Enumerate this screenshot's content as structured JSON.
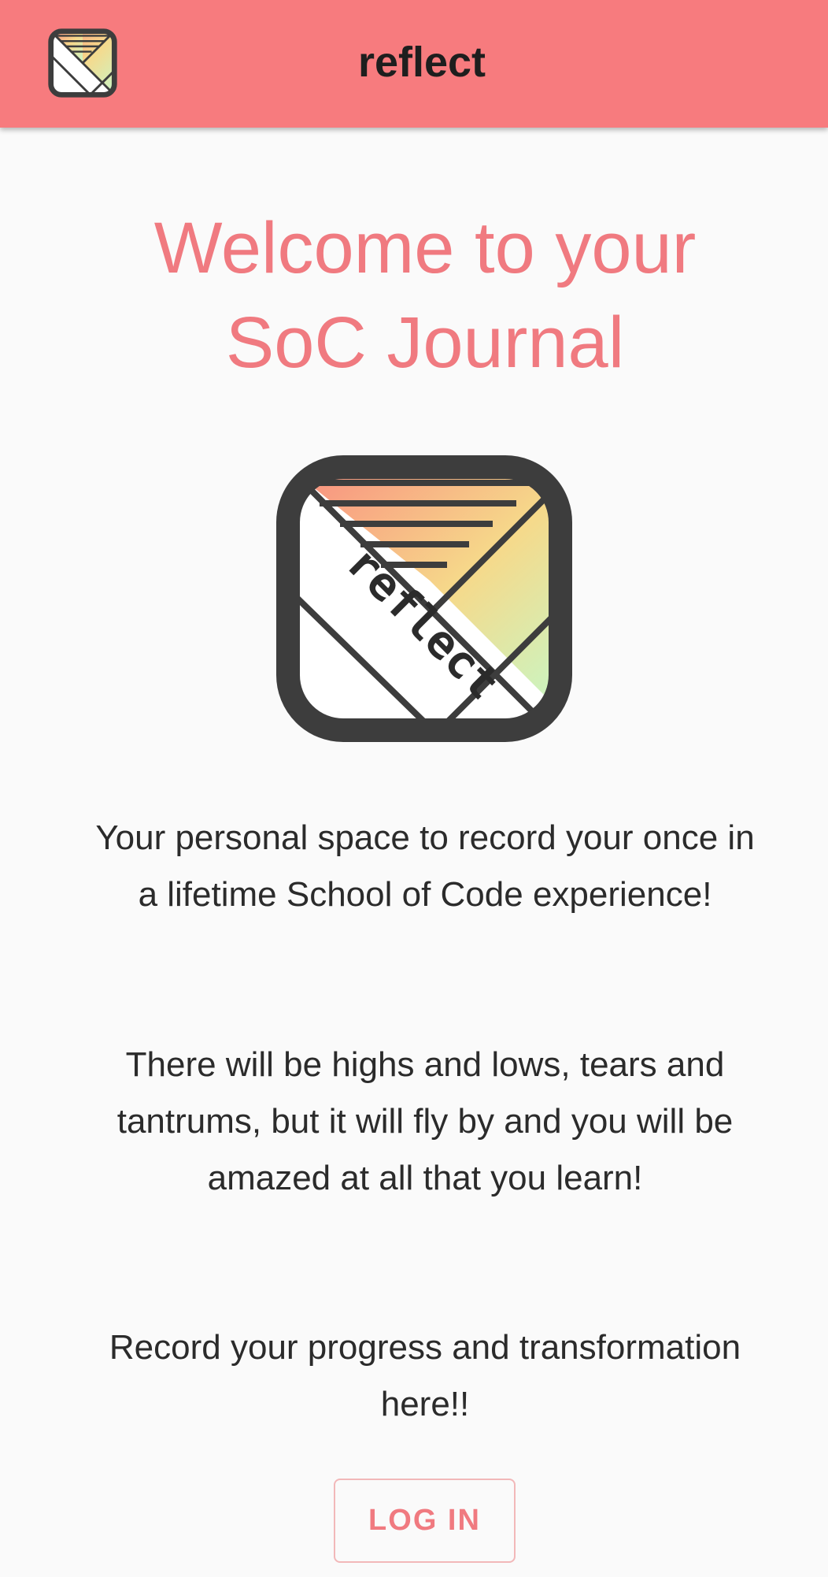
{
  "header": {
    "title": "reflect",
    "logo_icon": "reflect-app-logo-icon"
  },
  "main": {
    "welcome_line_1": "Welcome to your",
    "welcome_line_2": "SoC Journal",
    "logo_text": "reflect",
    "paragraph_1": "Your personal space to record your once in a lifetime School of Code experience!",
    "paragraph_2": "There will be highs and lows, tears and tantrums, but it will fly by and you will be amazed at all that you learn!",
    "paragraph_3": "Record your progress and transformation here!!",
    "login_label": "LOG IN"
  },
  "colors": {
    "header_bg": "#f77b7e",
    "accent": "#f07a80",
    "background": "#fafafa",
    "logo_frame": "#3d3d3d"
  }
}
